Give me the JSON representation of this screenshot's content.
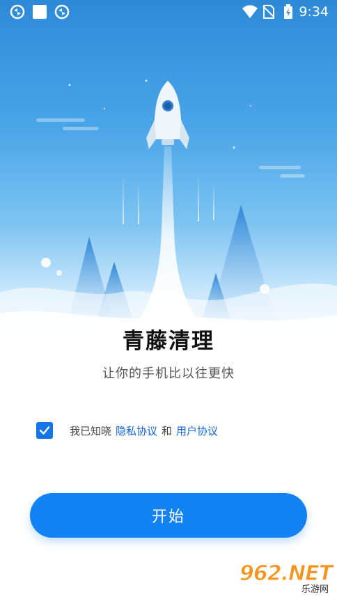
{
  "status_bar": {
    "time": "9:34",
    "icons": [
      "sync-icon",
      "square-icon",
      "sync-icon",
      "wifi-icon",
      "no-sim-icon",
      "battery-charging-icon"
    ]
  },
  "app": {
    "title": "青藤清理",
    "subtitle": "让你的手机比以往更快"
  },
  "agreement": {
    "checked": true,
    "prefix": "我已知晓",
    "privacy_link": "隐私协议",
    "and": "和",
    "user_link": "用户协议"
  },
  "start_button": {
    "label": "开始"
  },
  "watermark": {
    "logo": "962.NET",
    "caption": "乐游网"
  },
  "colors": {
    "accent": "#1382f5",
    "link": "#1266d6",
    "sky_top": "#2d8ad8"
  }
}
